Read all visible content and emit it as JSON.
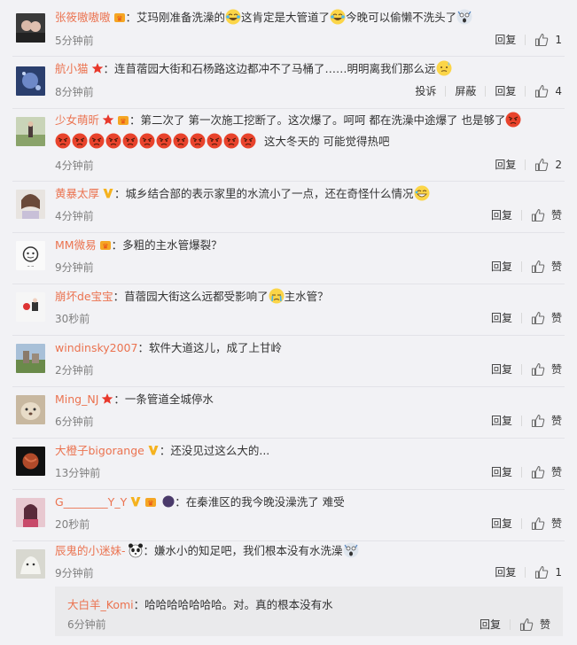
{
  "labels": {
    "reply": "回复",
    "like": "赞",
    "report": "投诉",
    "block": "屏蔽"
  },
  "colors": {
    "username": "#eb7350",
    "time": "#808080",
    "text": "#333333",
    "background": "#f2f2f5"
  },
  "comments": [
    {
      "user": "张筱嗷嗷嗷",
      "badges": [
        "vip-crown-icon"
      ],
      "colon": "：",
      "text": "艾玛刚准备洗澡的",
      "emojis_after": [
        "laugh-cry-emoji"
      ],
      "text2": "这肯定是大管道了",
      "emojis_after2": [
        "laugh-cry-emoji"
      ],
      "text3": "今晚可以偷懒不洗头了",
      "emojis_after3": [
        "shocked-emoji"
      ],
      "time": "5分钟前",
      "like_count": "1"
    },
    {
      "user": "航小猫",
      "badges": [
        "star-badge-icon"
      ],
      "colon": "：",
      "text": "连苜蓿园大街和石杨路这边都冲不了马桶了……明明离我们那么远",
      "emojis_after": [
        "sweat-emoji"
      ],
      "time": "8分钟前",
      "like_count": "4"
    },
    {
      "user": "少女萌昕",
      "badges": [
        "star-badge-icon",
        "vip-crown-icon"
      ],
      "colon": "：",
      "text": "第二次了 第一次施工挖断了。这次爆了。呵呵 都在洗澡中途爆了 也是够了",
      "emojis_after": [
        "angry-emoji"
      ],
      "angry_row_count": "12",
      "text2": "这大冬天的 可能觉得热吧",
      "time": "4分钟前",
      "like_count": "2"
    },
    {
      "user": "黄暴太厚",
      "badges": [
        "verified-v-icon"
      ],
      "colon": "：",
      "text": "城乡结合部的表示家里的水流小了一点，还在奇怪什么情况",
      "emojis_after": [
        "grin-emoji"
      ],
      "time": "4分钟前"
    },
    {
      "user": "MM微易",
      "badges": [
        "vip-crown-icon"
      ],
      "colon": "：",
      "text": "多粗的主水管爆裂？",
      "time": "9分钟前"
    },
    {
      "user": "崩坏de宝宝",
      "colon": "：",
      "text": "苜蓿园大街这么远都受影响了",
      "emojis_after": [
        "cry-emoji"
      ],
      "text2": "主水管？",
      "time": "30秒前"
    },
    {
      "user": "windinsky2007",
      "colon": "：",
      "text": "软件大道这儿，成了上甘岭",
      "time": "2分钟前"
    },
    {
      "user": "Ming_NJ",
      "badges": [
        "star-badge-icon"
      ],
      "colon": "：",
      "text": "一条管道全城停水",
      "time": "6分钟前"
    },
    {
      "user": "大橙子bigorange",
      "badges": [
        "verified-v-icon"
      ],
      "colon": "：",
      "text": "还没见过这么大的...",
      "time": "13分钟前"
    },
    {
      "user": "G________Y_Y",
      "badges": [
        "verified-v-icon",
        "vip-crown-icon",
        "night-badge-icon"
      ],
      "colon": "：",
      "text": "在秦淮区的我今晚没澡洗了 难受",
      "time": "20秒前"
    },
    {
      "user": "辰鬼的小迷妹-",
      "badges": [
        "panda-emoji"
      ],
      "colon": "：",
      "text": "嫌水小的知足吧，我们根本没有水洗澡",
      "emojis_after": [
        "shocked-emoji"
      ],
      "time": "9分钟前",
      "like_count": "1"
    }
  ],
  "reply": {
    "user": "大白羊_Komi",
    "colon": "：",
    "text": "哈哈哈哈哈哈哈。对。真的根本没有水",
    "time": "6分钟前"
  }
}
